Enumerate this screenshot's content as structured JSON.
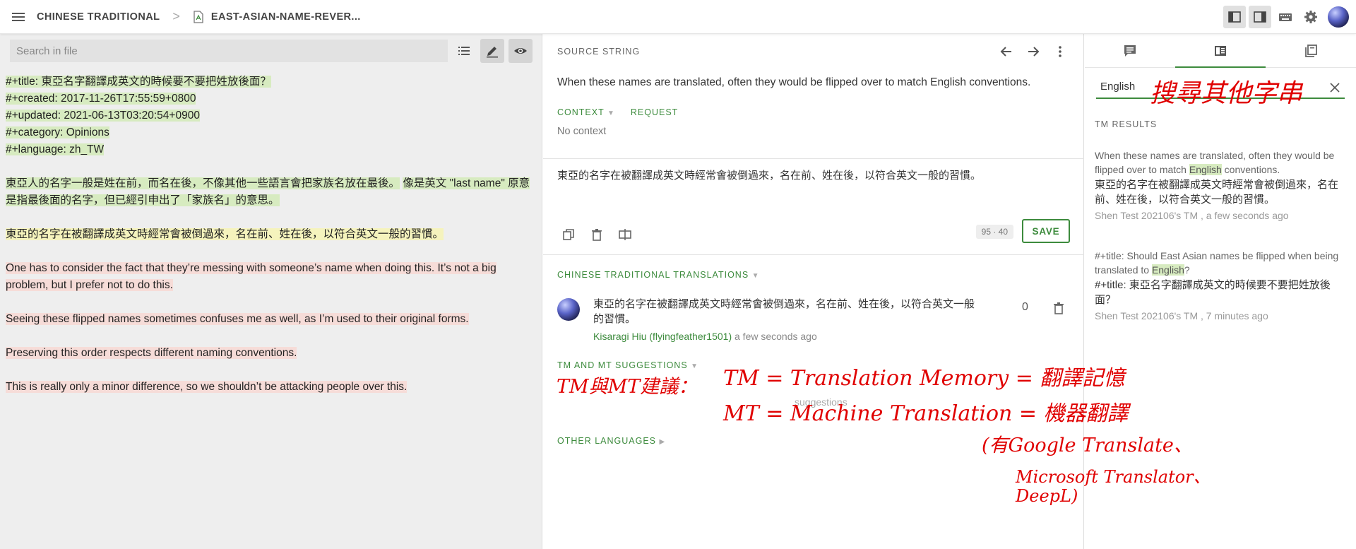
{
  "topbar": {
    "project": "CHINESE TRADITIONAL",
    "separator": ">",
    "file": "EAST-ASIAN-NAME-REVER..."
  },
  "left": {
    "search_placeholder": "Search in file",
    "doc": {
      "header_lines": [
        "#+title: 東亞名字翻譯成英文的時候要不要把姓放後面？",
        "#+created: 2017-11-26T17:55:59+0800",
        "#+updated: 2021-06-13T03:20:54+0900",
        "#+category: Opinions",
        "#+language: zh_TW"
      ],
      "para1_a": "東亞人的名字一般是姓在前，而名在後，不像其他一些語言會把家族名放在最後。",
      "para1_b": "像是英文 \"last name\" 原意是指最後面的名字，但已經引申出了「家族名」的意思。",
      "para2": "東亞的名字在被翻譯成英文時經常會被倒過來，名在前、姓在後，以符合英文一般的習慣。",
      "para3": "One has to consider the fact that they’re messing with someone’s name when doing this. It’s not a big problem, but I prefer not to do this.",
      "para4": "Seeing these flipped names sometimes confuses me as well, as I’m used to their original forms.",
      "para5": "Preserving this order respects different naming conventions.",
      "para6": "This is really only a minor difference, so we shouldn’t be attacking people over this."
    }
  },
  "middle": {
    "source_label": "SOURCE STRING",
    "source_text": "When these names are translated, often they would be flipped over to match English conventions.",
    "context_label": "CONTEXT",
    "request_label": "REQUEST",
    "no_context": "No context",
    "editor_text": "東亞的名字在被翻譯成英文時經常會被倒過來，名在前、姓在後，以符合英文一般的習慣。",
    "counter": "95 · 40",
    "save_label": "SAVE",
    "translations_label": "CHINESE TRADITIONAL TRANSLATIONS",
    "translation": {
      "text": "東亞的名字在被翻譯成英文時經常會被倒過來，名在前、姓在後，以符合英文一般的習慣。",
      "author": "Kisaragi Hiu (flyingfeather1501)",
      "time": "a few seconds ago",
      "votes": "0"
    },
    "tm_mt_label": "TM AND MT SUGGESTIONS",
    "suggestions_placeholder": "suggestions",
    "other_languages_label": "OTHER LANGUAGES"
  },
  "right": {
    "search_value": "English",
    "tm_results_label": "TM RESULTS",
    "results": [
      {
        "src_before": "When these names are translated, often they would be flipped over to match ",
        "src_match": "English",
        "src_after": " conventions.",
        "target": "東亞的名字在被翻譯成英文時經常會被倒過來，名在前、姓在後，以符合英文一般的習慣。",
        "meta": "Shen Test 202106's TM , a few seconds ago"
      },
      {
        "src_before": "#+title: Should East Asian names be flipped when being translated to ",
        "src_match": "English",
        "src_after": "?",
        "target": "#+title: 東亞名字翻譯成英文的時候要不要把姓放後面？",
        "meta": "Shen Test 202106's TM , 7 minutes ago"
      }
    ]
  },
  "annotations": {
    "search_note": "搜尋其他字串",
    "tm_mt_note": "TM與MT建議：",
    "tm_def": "TM = Translation Memory = 翻譯記憶",
    "mt_def": "MT = Machine Translation = 機器翻譯",
    "examples_1": "(有Google Translate、",
    "examples_2": "Microsoft Translator、",
    "examples_3": "DeepL)"
  },
  "colors": {
    "accent_green": "#3d8b3d",
    "highlight_green": "#d7ebc0",
    "highlight_yellow": "#f5f3bd",
    "highlight_red": "#f6dcd8",
    "annotation_red": "#e00000"
  }
}
